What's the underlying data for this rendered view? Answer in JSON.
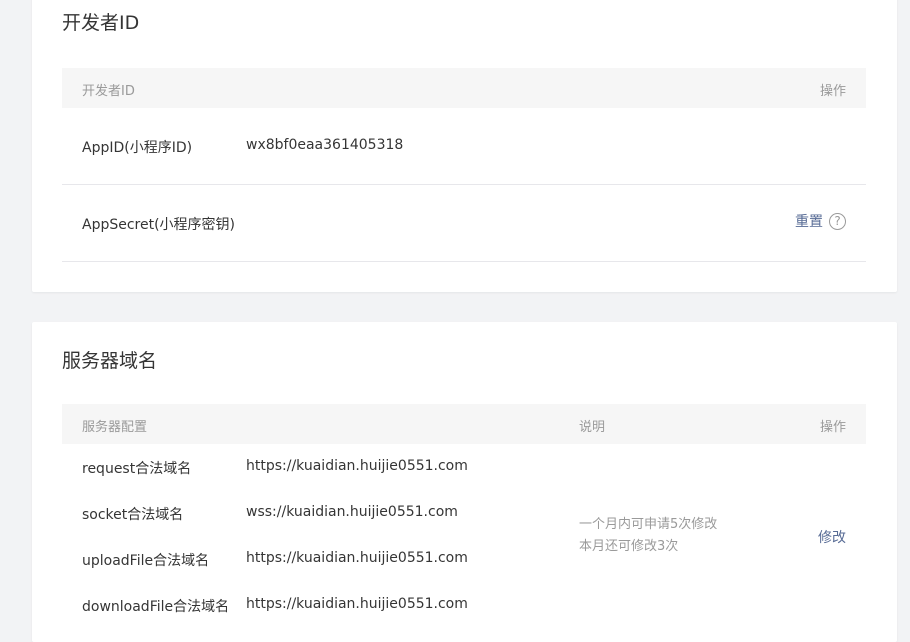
{
  "developer_id": {
    "title": "开发者ID",
    "table_header": {
      "col_name": "开发者ID",
      "col_action": "操作"
    },
    "rows": [
      {
        "label": "AppID(小程序ID)",
        "value": "wx8bf0eaa361405318"
      },
      {
        "label": "AppSecret(小程序密钥)",
        "action": "重置",
        "help_icon": "?"
      }
    ]
  },
  "server_domain": {
    "title": "服务器域名",
    "table_header": {
      "col_config": "服务器配置",
      "col_desc": "说明",
      "col_action": "操作"
    },
    "rows": [
      {
        "label": "request合法域名",
        "value": "https://kuaidian.huijie0551.com"
      },
      {
        "label": "socket合法域名",
        "value": "wss://kuaidian.huijie0551.com"
      },
      {
        "label": "uploadFile合法域名",
        "value": "https://kuaidian.huijie0551.com"
      },
      {
        "label": "downloadFile合法域名",
        "value": "https://kuaidian.huijie0551.com"
      }
    ],
    "note_line1": "一个月内可申请5次修改",
    "note_line2": "本月还可修改3次",
    "action": "修改"
  },
  "colors": {
    "link": "#576b95",
    "muted": "#9a9a9a",
    "header_bg": "#f6f6f6",
    "page_bg": "#f2f3f5"
  }
}
